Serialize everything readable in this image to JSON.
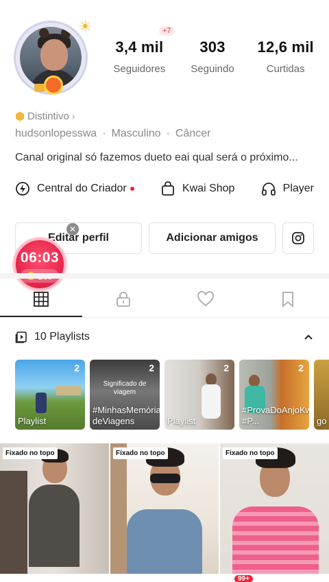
{
  "profile": {
    "stats": [
      {
        "value": "3,4 mil",
        "label": "Seguidores",
        "badge": "+7"
      },
      {
        "value": "303",
        "label": "Seguindo"
      },
      {
        "value": "12,6 mil",
        "label": "Curtidas"
      }
    ],
    "distintivo": "Distintivo",
    "username": "hudsonlopesswa",
    "gender": "Masculino",
    "sign": "Câncer",
    "bio": "Canal original só fazemos dueto eai qual será o próximo..."
  },
  "quick_links": {
    "creator": "Central do Criador",
    "shop": "Kwai Shop",
    "player": "Player"
  },
  "actions": {
    "edit": "Editar perfil",
    "add_friends": "Adicionar amigos"
  },
  "timer": {
    "time": "06:03",
    "coins": "169"
  },
  "playlists": {
    "header": "10 Playlists",
    "items": [
      {
        "label": "Playlist",
        "count": "2"
      },
      {
        "label": "#MinhasMemórias deViagens",
        "count": "2",
        "overlay": "Significado de viagem"
      },
      {
        "label": "Playlist",
        "count": "2"
      },
      {
        "label": "#ProvaDoAnjoKwaiLite #P...",
        "count": "2"
      },
      {
        "label": "go",
        "count": ""
      }
    ]
  },
  "videos": [
    {
      "pin": "Fixado no topo"
    },
    {
      "pin": "Fixado no topo"
    },
    {
      "pin": "Fixado no topo"
    }
  ],
  "bottom_badge": "99+",
  "colors": {
    "accent_red": "#f0243a",
    "timer_pink": "#e4234a"
  }
}
